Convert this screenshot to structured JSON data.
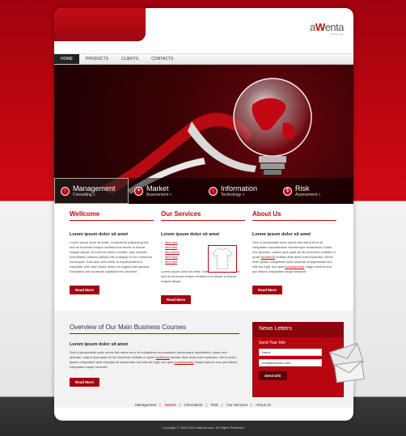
{
  "brand": {
    "logo_prefix": "a",
    "logo_v": "W",
    "logo_suffix": "enta",
    "tagline": "professional",
    "accent": "#c10712"
  },
  "nav": {
    "items": [
      "Home",
      "Products",
      "Clients",
      "Contacts"
    ]
  },
  "hero_menu": [
    {
      "title": "Management",
      "sub": "Consulting »",
      "icon": "arrow-up-icon"
    },
    {
      "title": "Market",
      "sub": "Assessment »",
      "icon": "compass-icon"
    },
    {
      "title": "Information",
      "sub": "Technology »",
      "icon": "arrow-up-icon"
    },
    {
      "title": "Risk",
      "sub": "Assessment »",
      "icon": "dollar-icon"
    }
  ],
  "welcome": {
    "heading": "Wellcome",
    "subheading": "Lorem ipsum dolor sit amet",
    "text": "Lorem ipsum dolor sit amet, consectetur adipisicing elit, sed do eiusmod tempor incididunt ut labore et dolore magna aliqua. Ut enim ad minim veniam, quis nostrud exercitation ullamco laboris nisi ut aliquip ex ea commodo consequat. Duis aute irure dolor in reprehenderit in voluptate velit esse cillum dolore eu fugiat nulla pariatur. Excepteur sint occaecat cupidatat non proident.",
    "button": "Read More"
  },
  "services": {
    "heading": "Our Services",
    "subheading": "Lorem ipsum dolor sit amet",
    "items": [
      "Item one",
      "Item two",
      "Item three",
      "Item four",
      "Item five"
    ],
    "text": "Lorem ipsum dolor sit amet, consectetur adipisicing elit, sed do eiusmod tempor incididunt ut labore et dolore magna aliqua.",
    "button": "Read More"
  },
  "about": {
    "heading": "About Us",
    "subheading": "Lorem ipsum dolor sit amet",
    "text_a": "Sed ut perspiciatis unde omnis iste natus error sit voluptatem accusantium doloremque laudantium, totam rem aperiam, eaque ipsa quae ab illo inventore veritatis et quasi ",
    "link_a": "architecto",
    "text_b": " beatae vitae dicta sunt explicabo. Nemo enim ipsam voluptatem quia voluptas sit aspernatur aut odit aut fugit, sed quia ",
    "link_b": "consequuntur",
    "text_c": " magni dolores eos qui ratione voluptatem sequi nesciunt.",
    "button": "Read More"
  },
  "overview": {
    "heading": "Overview of Our Main Business Courses",
    "subheading": "Lorem ipsum dolor sit amet",
    "text_a": "Sed ut perspiciatis unde omnis iste natus error sit voluptatem accusantium doloremque laudantium, totam rem aperiam, eaque ipsa quae ab illo inventore veritatis et quasi ",
    "link_a": "architecto",
    "text_b": " beatae vitae dicta sunt explicabo. Nemo enim ipsam voluptatem quia voluptas sit aspernatur aut odit aut fugit, sed quia ",
    "link_b": "consequuntur",
    "text_c": " magni dolores eos qui ratione voluptatem sequi nesciunt.",
    "button": "Read More"
  },
  "newsletter": {
    "heading": "News Letters",
    "label": "Send Your Info",
    "name_value": "Name",
    "email_value": "email@domain.com",
    "button": "Send Info"
  },
  "footer": {
    "links": [
      "Management",
      "Market",
      "Information",
      "Risk",
      "Our Services",
      "About Us"
    ],
    "copyright": "Copyright © 2006-2010 awenta.com. All Rights Reserved"
  }
}
